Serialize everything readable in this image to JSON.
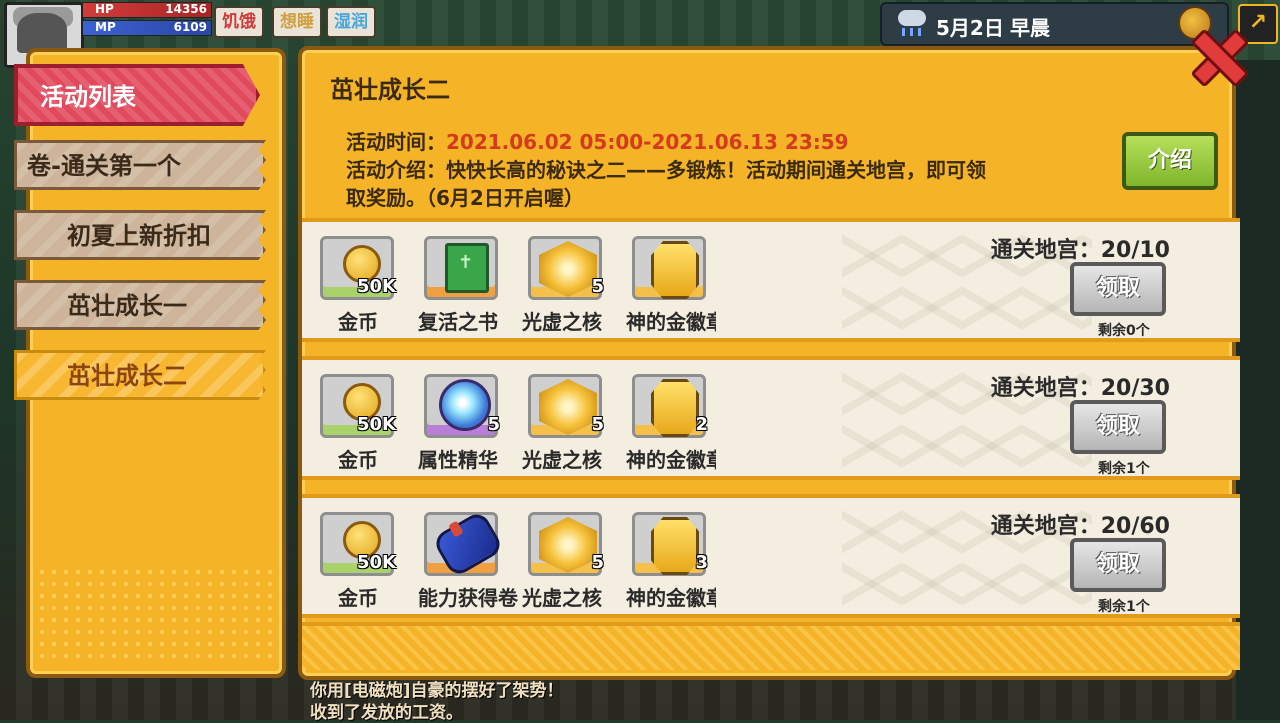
{
  "hud": {
    "hp_label": "HP",
    "hp_value": "14356",
    "mp_label": "MP",
    "mp_value": "6109",
    "status": [
      "饥饿",
      "想睡",
      "湿润"
    ]
  },
  "weather": {
    "date": "5月2日",
    "time": "早晨"
  },
  "sidebar": {
    "header": "活动列表",
    "items": [
      {
        "label": "卷-通关第一个"
      },
      {
        "label": "初夏上新折扣"
      },
      {
        "label": "茁壮成长一"
      },
      {
        "label": "茁壮成长二"
      }
    ]
  },
  "main": {
    "title": "茁壮成长二",
    "time_label": "活动时间：",
    "time_value": "2021.06.02 05:00-2021.06.13 23:59",
    "intro_line1": "活动介绍：快快长高的秘诀之二——多锻炼！活动期间通关地宫，即可领",
    "intro_line2": "取奖励。（6月2日开启喔）",
    "intro_button": "介绍"
  },
  "rewards": [
    {
      "progress": "通关地宫：20/10",
      "claim": "领取",
      "remaining": "剩余0个",
      "items": [
        {
          "name": "金币",
          "qty": "50K",
          "icon": "coin-icon"
        },
        {
          "name": "复活之书",
          "qty": "",
          "icon": "book-icon"
        },
        {
          "name": "光虚之核",
          "qty": "5",
          "icon": "core-icon"
        },
        {
          "name": "神的金徽章",
          "qty": "",
          "icon": "badge-icon"
        }
      ]
    },
    {
      "progress": "通关地宫：20/30",
      "claim": "领取",
      "remaining": "剩余1个",
      "items": [
        {
          "name": "金币",
          "qty": "50K",
          "icon": "coin-icon"
        },
        {
          "name": "属性精华",
          "qty": "5",
          "icon": "orb-icon"
        },
        {
          "name": "光虚之核",
          "qty": "5",
          "icon": "core-icon"
        },
        {
          "name": "神的金徽章",
          "qty": "2",
          "icon": "badge-icon"
        }
      ]
    },
    {
      "progress": "通关地宫：20/60",
      "claim": "领取",
      "remaining": "剩余1个",
      "items": [
        {
          "name": "金币",
          "qty": "50K",
          "icon": "coin-icon"
        },
        {
          "name": "能力获得卷轴",
          "qty": "",
          "icon": "scroll-icon"
        },
        {
          "name": "光虚之核",
          "qty": "5",
          "icon": "core-icon"
        },
        {
          "name": "神的金徽章",
          "qty": "3",
          "icon": "badge-icon"
        }
      ]
    }
  ],
  "log": [
    "你用[电磁炮]自豪的摆好了架势！",
    "收到了发放的工资。"
  ],
  "colors": {
    "panel": "#f5b327",
    "active_tab": "#e14a5d",
    "time_text": "#d43a1c",
    "intro_button": "#8fc23a"
  }
}
